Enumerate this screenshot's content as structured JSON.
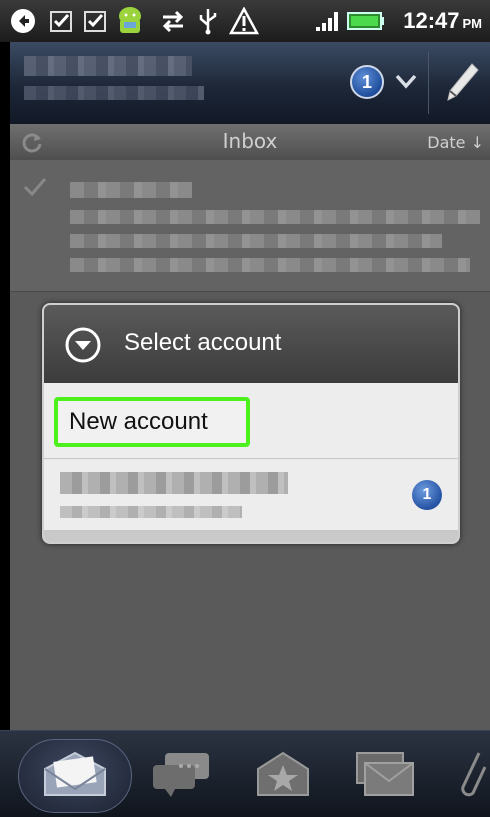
{
  "status_bar": {
    "time": "12:47",
    "ampm": "PM",
    "icons": [
      "back-arrow-icon",
      "checkbox-icon",
      "checkbox-icon",
      "android-icon",
      "sync-arrows-icon",
      "usb-icon",
      "warning-icon",
      "signal-icon",
      "battery-icon"
    ]
  },
  "app_bar": {
    "unread_count": "1"
  },
  "inbox_bar": {
    "title": "Inbox",
    "sort_label": "Date"
  },
  "dialog": {
    "title": "Select account",
    "new_account_label": "New account",
    "account_unread": "1"
  },
  "tabs": [
    "inbox-tab",
    "conversations-tab",
    "favorites-tab",
    "unread-tab",
    "attachments-tab"
  ],
  "colors": {
    "highlight": "#4cf01a",
    "badge_blue": "#2553a3",
    "dialog_header": "#3c3c3c"
  }
}
